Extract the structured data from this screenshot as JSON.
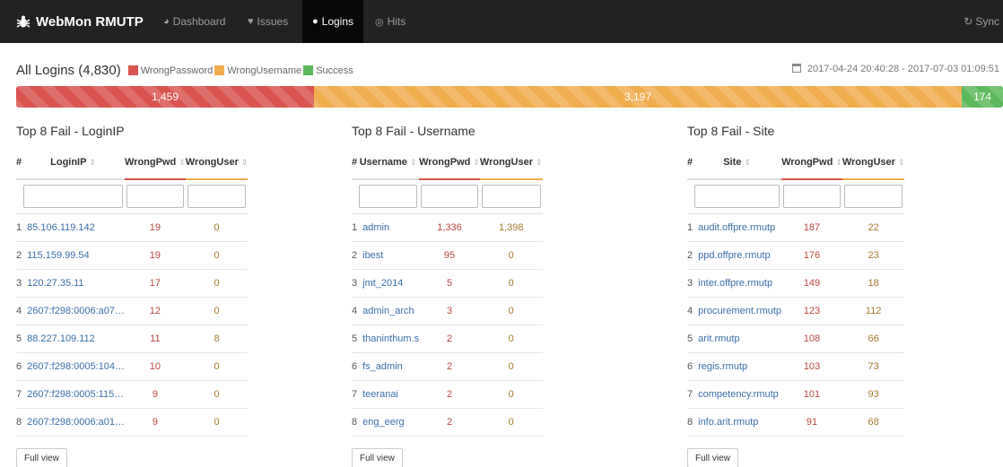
{
  "nav": {
    "brand": "WebMon RMUTP",
    "items": [
      {
        "label": "Dashboard",
        "icon": "dashboard-icon"
      },
      {
        "label": "Issues",
        "icon": "heart-icon"
      },
      {
        "label": "Logins",
        "icon": "user-icon"
      },
      {
        "label": "Hits",
        "icon": "target-icon"
      }
    ],
    "active": "Logins",
    "sync_label": "Sync"
  },
  "summary": {
    "title": "All Logins (4,830)",
    "legend": [
      {
        "label": "WrongPassword",
        "color": "#d9534f"
      },
      {
        "label": "WrongUsername",
        "color": "#f0ad4e"
      },
      {
        "label": "Success",
        "color": "#5cb85c"
      }
    ],
    "date_range": "2017-04-24 20:40:28 - 2017-07-03 01:09:51",
    "bars": [
      {
        "label": "1,459",
        "value": 1459,
        "color": "#d9534f"
      },
      {
        "label": "3,197",
        "value": 3197,
        "color": "#f0ad4e"
      },
      {
        "label": "174",
        "value": 174,
        "color": "#5cb85c"
      }
    ]
  },
  "panels": [
    {
      "title": "Top 8 Fail - LoginIP",
      "columns": [
        "#",
        "LoginIP",
        "WrongPwd",
        "WrongUser"
      ],
      "rows": [
        [
          "1",
          "85.106.119.142",
          "19",
          "0"
        ],
        [
          "2",
          "115.159.99.54",
          "19",
          "0"
        ],
        [
          "3",
          "120.27.35.11",
          "17",
          "0"
        ],
        [
          "4",
          "2607:f298:0006:a07…",
          "12",
          "0"
        ],
        [
          "5",
          "88.227.109.112",
          "11",
          "8"
        ],
        [
          "6",
          "2607:f298:0005:104…",
          "10",
          "0"
        ],
        [
          "7",
          "2607:f298:0005:115…",
          "9",
          "0"
        ],
        [
          "8",
          "2607:f298:0006:a01…",
          "9",
          "0"
        ]
      ],
      "button": "Full view"
    },
    {
      "title": "Top 8 Fail - Username",
      "columns": [
        "#",
        "Username",
        "WrongPwd",
        "WrongUser"
      ],
      "rows": [
        [
          "1",
          "admin",
          "1,336",
          "1,398"
        ],
        [
          "2",
          "ibest",
          "95",
          "0"
        ],
        [
          "3",
          "jmt_2014",
          "5",
          "0"
        ],
        [
          "4",
          "admin_arch",
          "3",
          "0"
        ],
        [
          "5",
          "thaninthum.s",
          "2",
          "0"
        ],
        [
          "6",
          "fs_admin",
          "2",
          "0"
        ],
        [
          "7",
          "teeranai",
          "2",
          "0"
        ],
        [
          "8",
          "eng_eerg",
          "2",
          "0"
        ]
      ],
      "button": "Full view"
    },
    {
      "title": "Top 8 Fail - Site",
      "columns": [
        "#",
        "Site",
        "WrongPwd",
        "WrongUser"
      ],
      "rows": [
        [
          "1",
          "audit.offpre.rmutp",
          "187",
          "22"
        ],
        [
          "2",
          "ppd.offpre.rmutp",
          "176",
          "23"
        ],
        [
          "3",
          "inter.offpre.rmutp",
          "149",
          "18"
        ],
        [
          "4",
          "procurement.rmutp",
          "123",
          "112"
        ],
        [
          "5",
          "arit.rmutp",
          "108",
          "66"
        ],
        [
          "6",
          "regis.rmutp",
          "103",
          "73"
        ],
        [
          "7",
          "competency.rmutp",
          "101",
          "93"
        ],
        [
          "8",
          "info.arit.rmutp",
          "91",
          "68"
        ]
      ],
      "button": "Full view"
    }
  ]
}
